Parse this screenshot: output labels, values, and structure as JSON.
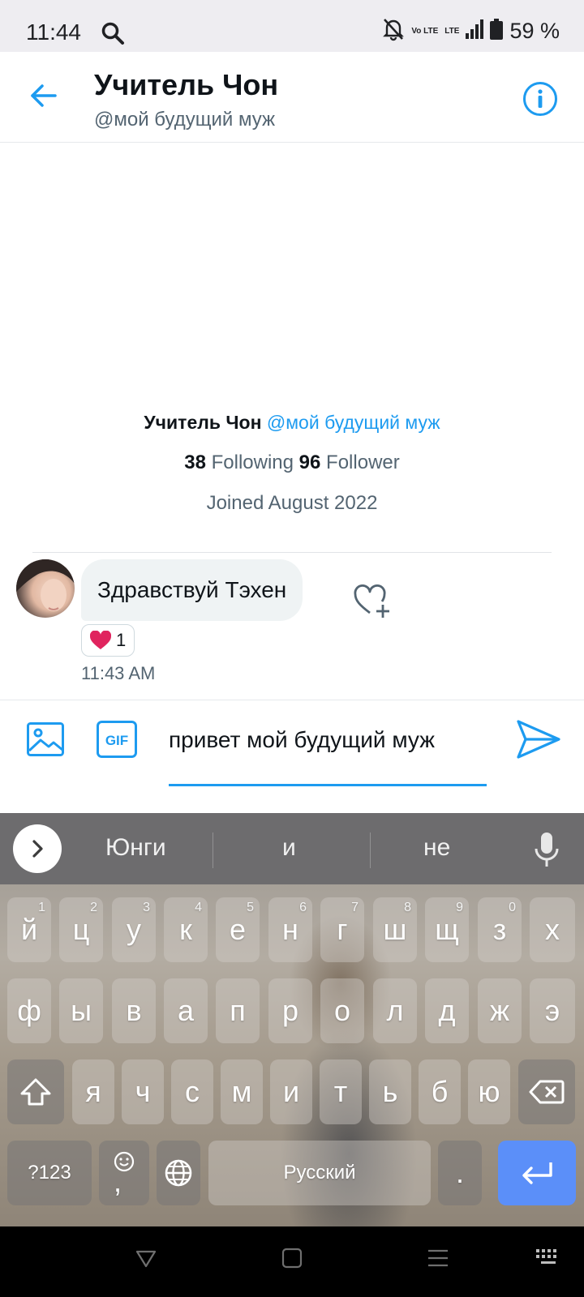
{
  "status_bar": {
    "time": "11:44",
    "battery_percent": "59 %",
    "network_labels": [
      "Vo LTE",
      "LTE"
    ],
    "icons": [
      "search-icon",
      "notifications-off-icon",
      "signal-icon",
      "battery-icon"
    ]
  },
  "header": {
    "title": "Учитель Чон",
    "subtitle": "@мой будущий муж",
    "icons": [
      "back-arrow-icon",
      "info-icon"
    ]
  },
  "profile": {
    "name": "Учитель Чон",
    "handle": "@мой будущий муж",
    "following_count": "38",
    "following_label": "Following",
    "follower_count": "96",
    "follower_label": "Follower",
    "joined": "Joined August 2022"
  },
  "message": {
    "text": "Здравствуй Тэхен",
    "reaction_emoji": "❤️",
    "reaction_count": "1",
    "time": "11:43 AM"
  },
  "composer": {
    "input_value": "привет мой будущий муж",
    "gif_label": "GIF",
    "icons": [
      "image-icon",
      "gif-icon",
      "send-icon"
    ]
  },
  "keyboard": {
    "suggestions": [
      "Юнги",
      "и",
      "не"
    ],
    "row1": [
      {
        "k": "й",
        "n": "1"
      },
      {
        "k": "ц",
        "n": "2"
      },
      {
        "k": "у",
        "n": "3"
      },
      {
        "k": "к",
        "n": "4"
      },
      {
        "k": "е",
        "n": "5"
      },
      {
        "k": "н",
        "n": "6"
      },
      {
        "k": "г",
        "n": "7"
      },
      {
        "k": "ш",
        "n": "8"
      },
      {
        "k": "щ",
        "n": "9"
      },
      {
        "k": "з",
        "n": "0"
      },
      {
        "k": "х",
        "n": ""
      }
    ],
    "row2": [
      "ф",
      "ы",
      "в",
      "а",
      "п",
      "р",
      "о",
      "л",
      "д",
      "ж",
      "э"
    ],
    "row3": [
      "я",
      "ч",
      "с",
      "м",
      "и",
      "т",
      "ь",
      "б",
      "ю"
    ],
    "symbols_label": "?123",
    "comma_label": ",",
    "space_label": "Русский",
    "period_label": ".",
    "icons": [
      "chevron-right-icon",
      "microphone-icon",
      "shift-icon",
      "backspace-icon",
      "emoji-icon",
      "globe-icon",
      "enter-icon"
    ]
  },
  "nav_bar": {
    "icons": [
      "back-triangle-icon",
      "home-square-icon",
      "recents-icon",
      "keyboard-icon"
    ]
  },
  "colors": {
    "accent": "#1d9bf0",
    "secondary_text": "#536471",
    "bubble_bg": "#eff3f4",
    "enter_key": "#5b8ff9"
  }
}
